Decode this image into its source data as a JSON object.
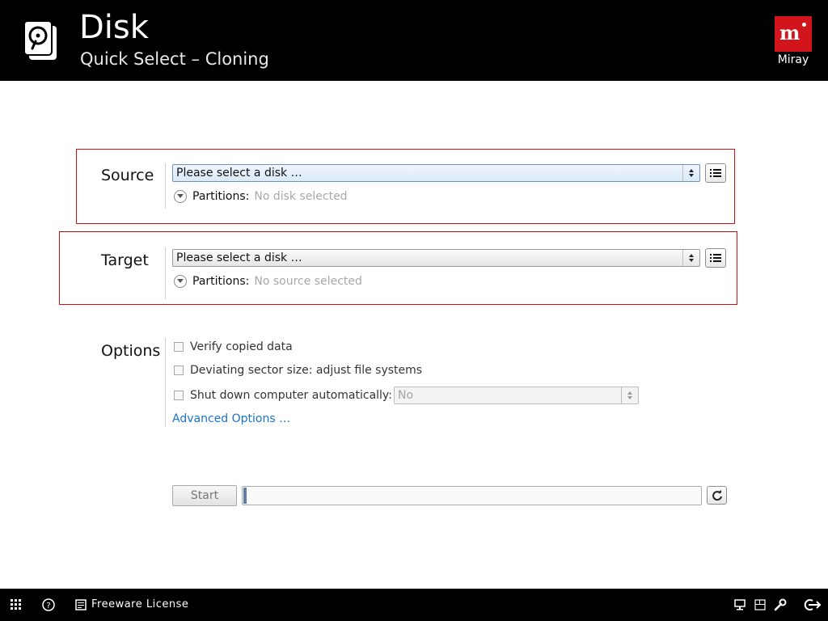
{
  "header": {
    "title": "Disk",
    "subtitle": "Quick Select – Cloning",
    "brand_name": "Miray",
    "brand_logo_text": "m"
  },
  "source": {
    "label": "Source",
    "select_value": "Please select a disk …",
    "partitions_label": "Partitions:",
    "partitions_value": "No disk selected"
  },
  "target": {
    "label": "Target",
    "select_value": "Please select a disk …",
    "partitions_label": "Partitions:",
    "partitions_value": "No source selected"
  },
  "options": {
    "label": "Options",
    "verify_label": "Verify copied data",
    "deviating_label": "Deviating sector size: adjust file systems",
    "shutdown_label": "Shut down computer automatically:",
    "shutdown_value": "No",
    "advanced_link": "Advanced Options …"
  },
  "actions": {
    "start_label": "Start",
    "progress": 0
  },
  "footer": {
    "license_label": "Freeware License",
    "icons": [
      "apps-grid-icon",
      "help-icon",
      "license-icon",
      "monitor-icon",
      "window-icon",
      "wrench-icon",
      "exit-icon"
    ]
  },
  "colors": {
    "header_bg": "#000000",
    "highlight_border": "#d01010",
    "brand": "#d2141c",
    "link": "#1a73c9"
  }
}
